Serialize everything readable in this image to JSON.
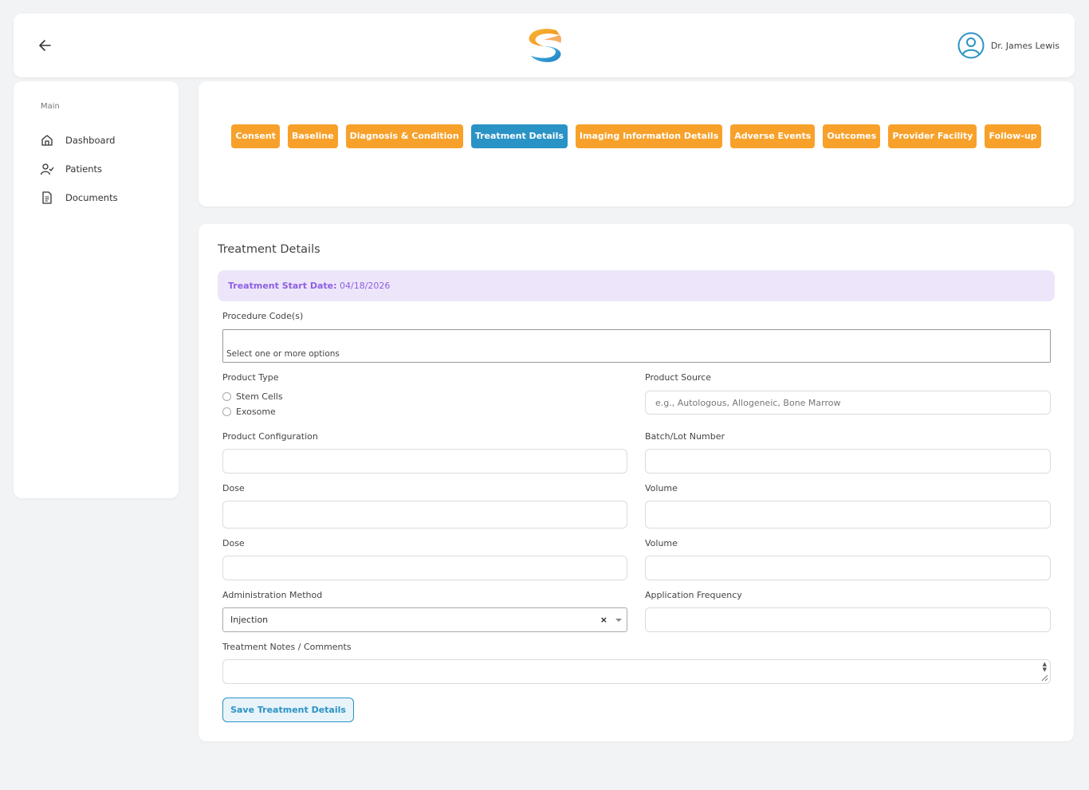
{
  "header": {
    "user_name": "Dr. James Lewis"
  },
  "sidebar": {
    "section_label": "Main",
    "items": [
      {
        "label": "Dashboard",
        "icon": "home-icon"
      },
      {
        "label": "Patients",
        "icon": "user-check-icon"
      },
      {
        "label": "Documents",
        "icon": "document-icon"
      }
    ]
  },
  "tabs": [
    {
      "label": "Consent",
      "active": false
    },
    {
      "label": "Baseline",
      "active": false
    },
    {
      "label": "Diagnosis & Condition",
      "active": false
    },
    {
      "label": "Treatment Details",
      "active": true
    },
    {
      "label": "Imaging Information Details",
      "active": false
    },
    {
      "label": "Adverse Events",
      "active": false
    },
    {
      "label": "Outcomes",
      "active": false
    },
    {
      "label": "Provider Facility",
      "active": false
    },
    {
      "label": "Follow-up",
      "active": false
    }
  ],
  "form": {
    "title": "Treatment Details",
    "banner_label": "Treatment Start Date:",
    "banner_value": " 04/18/2026",
    "procedure_codes": {
      "label": "Procedure Code(s)",
      "placeholder": "Select one or more options"
    },
    "product_type": {
      "label": "Product Type",
      "options": [
        "Stem Cells",
        "Exosome"
      ],
      "selected": null
    },
    "product_source": {
      "label": "Product Source",
      "placeholder": "e.g., Autologous, Allogeneic, Bone Marrow",
      "value": ""
    },
    "product_configuration": {
      "label": "Product Configuration",
      "value": ""
    },
    "batch_lot_number": {
      "label": "Batch/Lot Number",
      "value": ""
    },
    "dose_1": {
      "label": "Dose",
      "value": ""
    },
    "volume_1": {
      "label": "Volume",
      "value": ""
    },
    "dose_2": {
      "label": "Dose",
      "value": ""
    },
    "volume_2": {
      "label": "Volume",
      "value": ""
    },
    "administration_method": {
      "label": "Administration Method",
      "value": "Injection"
    },
    "application_frequency": {
      "label": "Application Frequency",
      "value": ""
    },
    "treatment_notes": {
      "label": "Treatment Notes / Comments",
      "value": ""
    },
    "save_label": "Save Treatment Details"
  },
  "colors": {
    "accent_orange": "#f7a12a",
    "accent_blue": "#2a93c6",
    "banner_purple": "#8e5fe0",
    "banner_bg": "#ede6fb"
  }
}
